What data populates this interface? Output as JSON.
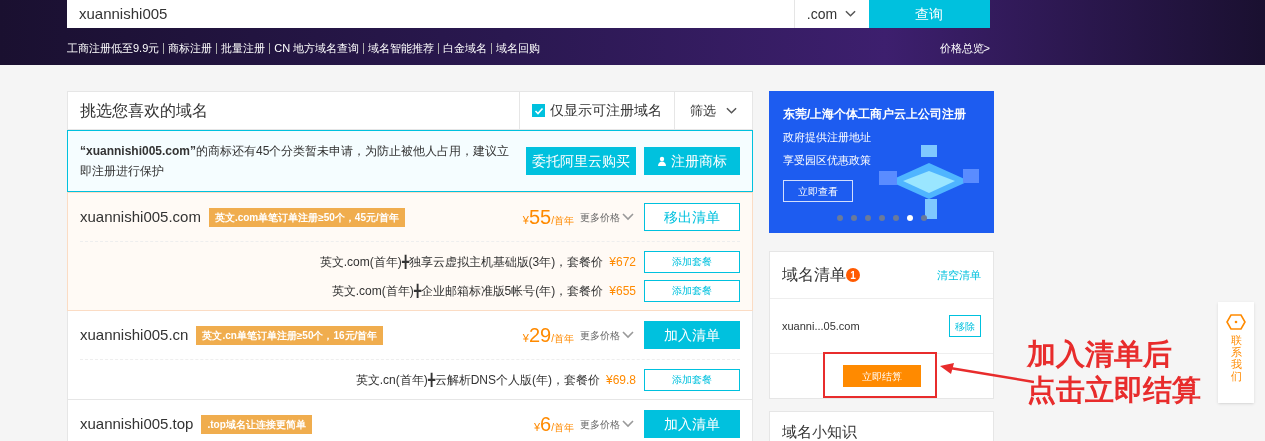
{
  "search": {
    "value": "xuannishi005",
    "suffix": ".com",
    "button": "查询"
  },
  "quick_links": [
    "工商注册低至9.9元",
    "商标注册",
    "批量注册",
    "CN 地方域名查询",
    "域名智能推荐",
    "白金域名",
    "域名回购"
  ],
  "price_overview": "价格总览>",
  "list_header": {
    "title": "挑选您喜欢的域名",
    "only_available": {
      "label": "仅显示可注册域名",
      "checked": true
    },
    "filter": "筛选"
  },
  "notice": {
    "text": "**“xuannishi005.com”**的商标还有45个分类暂未申请，为防止被他人占用，建议立即注册进行保护",
    "buttons": [
      "委托阿里云购买",
      "注册商标"
    ]
  },
  "domains": [
    {
      "name": "xuannishi005.com",
      "promo": "英文.com单笔订单注册≥50个，45元/首年",
      "currency": "¥",
      "price": "55",
      "unit": "/首年",
      "more": "更多价格",
      "in_cart": true,
      "action": "移出清单",
      "packages": [
        {
          "text": "英文.com(首年)╋独享云虚拟主机基础版(3年)，套餐价",
          "price": "¥672",
          "button": "添加套餐"
        },
        {
          "text": "英文.com(首年)╋企业邮箱标准版5帐号(年)，套餐价",
          "price": "¥655",
          "button": "添加套餐"
        }
      ]
    },
    {
      "name": "xuannishi005.cn",
      "promo": "英文.cn单笔订单注册≥50个，16元/首年",
      "currency": "¥",
      "price": "29",
      "unit": "/首年",
      "more": "更多价格",
      "in_cart": false,
      "action": "加入清单",
      "packages": [
        {
          "text": "英文.cn(首年)╋云解析DNS个人版(年)，套餐价",
          "price": "¥69.8",
          "button": "添加套餐"
        }
      ]
    },
    {
      "name": "xuannishi005.top",
      "promo": ".top域名让连接更简单",
      "currency": "¥",
      "price": "6",
      "unit": "/首年",
      "more": "更多价格",
      "in_cart": false,
      "action": "加入清单"
    }
  ],
  "banner": {
    "title": "东莞/上海个体工商户云上公司注册",
    "lines": [
      "政府提供注册地址",
      "享受园区优惠政策"
    ],
    "button": "立即查看",
    "dots": [
      {
        "selected": false
      },
      {
        "selected": false
      },
      {
        "selected": false
      },
      {
        "selected": false
      },
      {
        "selected": false
      },
      {
        "selected": true
      },
      {
        "selected": false
      }
    ]
  },
  "cart": {
    "title": "域名清单",
    "count": "1",
    "clear": "清空清单",
    "items": [
      {
        "name": "xuanni...05.com",
        "button": "移除"
      }
    ],
    "checkout": "立即结算"
  },
  "next_card": {
    "title": "域名小知识"
  },
  "annotation": {
    "lines": [
      "加入清单后",
      "点击立即结算"
    ]
  },
  "contact_tab": "联系我们"
}
